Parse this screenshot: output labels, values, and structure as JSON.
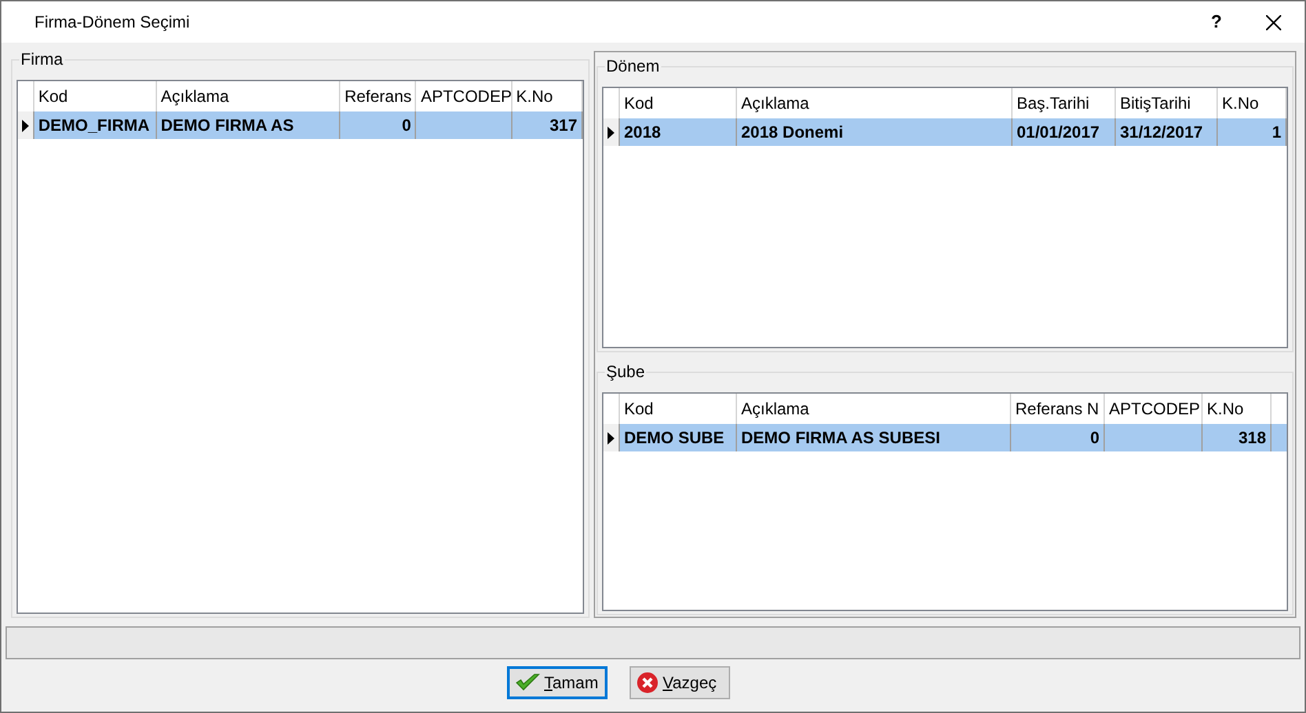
{
  "window": {
    "title": "Firma-Dönem Seçimi",
    "help": "?"
  },
  "groups": [
    {
      "title": "Firma",
      "columns": [
        {
          "label": "Kod",
          "kind": "text"
        },
        {
          "label": "Açıklama",
          "kind": "text"
        },
        {
          "label": "Referans",
          "kind": "number"
        },
        {
          "label": "APTCODEP",
          "kind": "text"
        },
        {
          "label": "K.No",
          "kind": "number"
        }
      ],
      "rows": [
        {
          "selected": true,
          "cells": [
            "DEMO_FIRMA",
            "DEMO FIRMA AS",
            "0",
            "",
            "317"
          ]
        }
      ]
    },
    {
      "title": "Dönem",
      "columns": [
        {
          "label": "Kod",
          "kind": "text"
        },
        {
          "label": "Açıklama",
          "kind": "text"
        },
        {
          "label": "Baş.Tarihi",
          "kind": "text"
        },
        {
          "label": "BitişTarihi",
          "kind": "text"
        },
        {
          "label": "K.No",
          "kind": "number"
        }
      ],
      "rows": [
        {
          "selected": true,
          "cells": [
            "2018",
            "2018 Donemi",
            "01/01/2017",
            "31/12/2017",
            "1"
          ]
        }
      ]
    },
    {
      "title": "Şube",
      "columns": [
        {
          "label": "Kod",
          "kind": "text"
        },
        {
          "label": "Açıklama",
          "kind": "text"
        },
        {
          "label": "Referans N",
          "kind": "number"
        },
        {
          "label": "APTCODEP",
          "kind": "text"
        },
        {
          "label": "K.No",
          "kind": "number"
        }
      ],
      "rows": [
        {
          "selected": true,
          "cells": [
            "DEMO SUBE",
            "DEMO FIRMA AS SUBESI",
            "0",
            "",
            "318"
          ]
        }
      ]
    }
  ],
  "buttons": [
    {
      "label": "Tamam",
      "kind": "ok",
      "selected": true
    },
    {
      "label": "Vazgeç",
      "kind": "cancel",
      "selected": false
    }
  ]
}
